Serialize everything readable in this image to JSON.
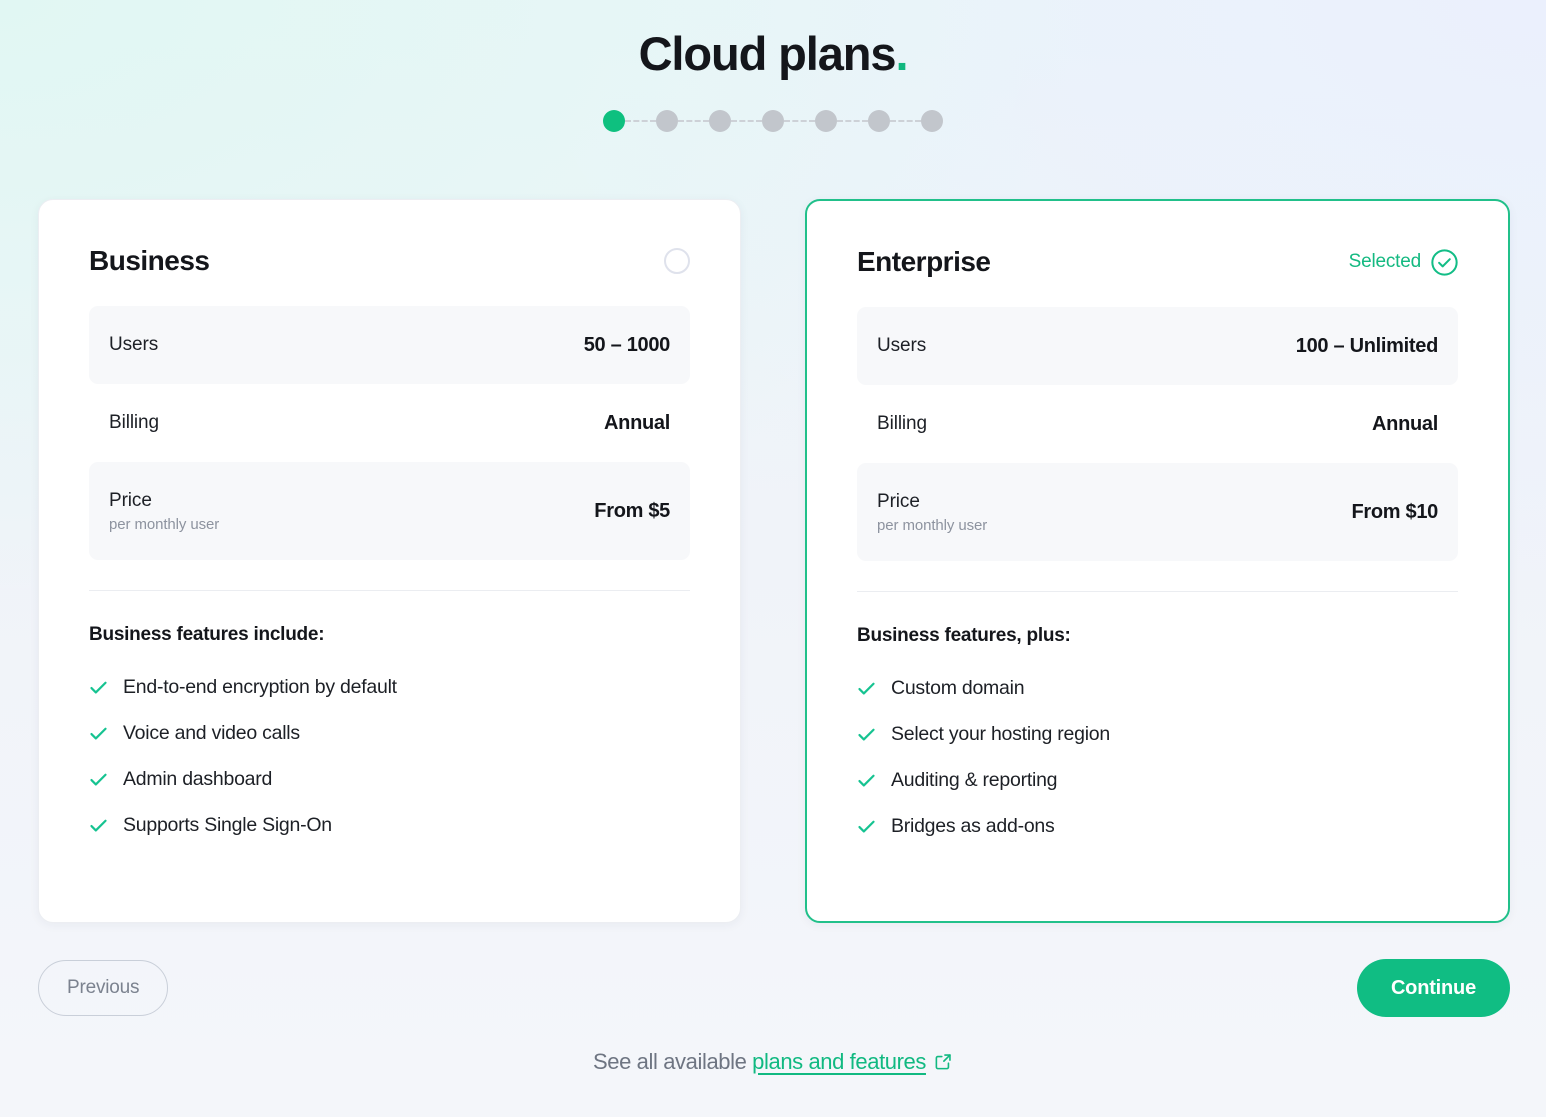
{
  "header": {
    "title": "Cloud plans",
    "title_dot": ".",
    "accent_color": "#10b77f"
  },
  "stepper": {
    "total_steps": 7,
    "current_step": 1,
    "active_color": "#0ec07f",
    "inactive_color": "#c2c6cc"
  },
  "plans": [
    {
      "name": "Business",
      "selected": false,
      "select_control": "radio-unselected",
      "specs": [
        {
          "label": "Users",
          "sub": null,
          "value": "50 – 1000",
          "shaded": true
        },
        {
          "label": "Billing",
          "sub": null,
          "value": "Annual",
          "shaded": false
        },
        {
          "label": "Price",
          "sub": "per monthly user",
          "value": "From $5",
          "shaded": true
        }
      ],
      "features_title": "Business features include:",
      "features": [
        "End-to-end encryption by default",
        "Voice and video calls",
        "Admin dashboard",
        "Supports Single Sign-On"
      ]
    },
    {
      "name": "Enterprise",
      "selected": true,
      "selected_label": "Selected",
      "select_control": "check-circle",
      "specs": [
        {
          "label": "Users",
          "sub": null,
          "value": "100 – Unlimited",
          "shaded": true
        },
        {
          "label": "Billing",
          "sub": null,
          "value": "Annual",
          "shaded": false
        },
        {
          "label": "Price",
          "sub": "per monthly user",
          "value": "From $10",
          "shaded": true
        }
      ],
      "features_title": "Business features, plus:",
      "features": [
        "Custom domain",
        "Select your hosting region",
        "Auditing & reporting",
        "Bridges as add-ons"
      ]
    }
  ],
  "nav": {
    "previous_label": "Previous",
    "continue_label": "Continue",
    "continue_color": "#10bd83"
  },
  "footer": {
    "prefix": "See all available ",
    "link_label": "plans and features",
    "link_color": "#11b981",
    "external_icon": "external-link-icon"
  }
}
